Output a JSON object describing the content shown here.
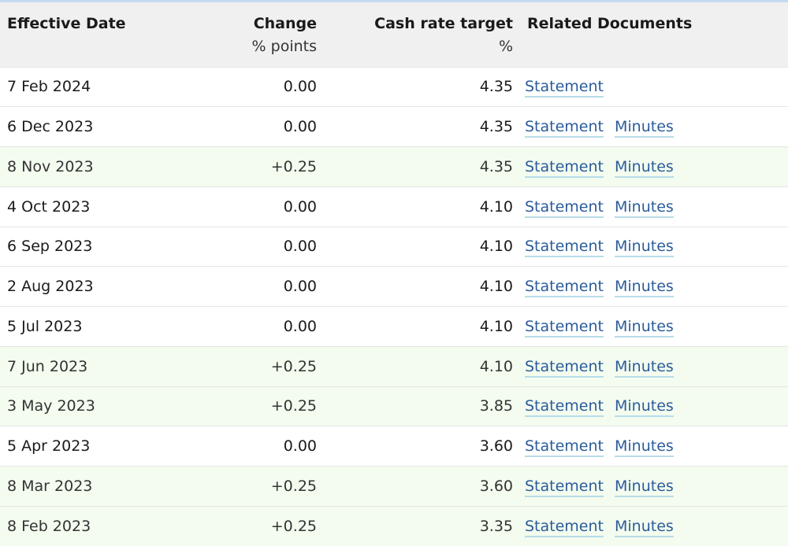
{
  "table": {
    "headers": {
      "date": "Effective Date",
      "change": "Change",
      "change_unit": "% points",
      "rate": "Cash rate target",
      "rate_unit": "%",
      "docs": "Related Documents"
    },
    "rows": [
      {
        "date": "7 Feb 2024",
        "change": "0.00",
        "rate": "4.35",
        "statement": "Statement",
        "minutes": "",
        "hike": false
      },
      {
        "date": "6 Dec 2023",
        "change": "0.00",
        "rate": "4.35",
        "statement": "Statement",
        "minutes": "Minutes",
        "hike": false
      },
      {
        "date": "8 Nov 2023",
        "change": "+0.25",
        "rate": "4.35",
        "statement": "Statement",
        "minutes": "Minutes",
        "hike": true
      },
      {
        "date": "4 Oct 2023",
        "change": "0.00",
        "rate": "4.10",
        "statement": "Statement",
        "minutes": "Minutes",
        "hike": false
      },
      {
        "date": "6 Sep 2023",
        "change": "0.00",
        "rate": "4.10",
        "statement": "Statement",
        "minutes": "Minutes",
        "hike": false
      },
      {
        "date": "2 Aug 2023",
        "change": "0.00",
        "rate": "4.10",
        "statement": "Statement",
        "minutes": "Minutes",
        "hike": false
      },
      {
        "date": "5 Jul 2023",
        "change": "0.00",
        "rate": "4.10",
        "statement": "Statement",
        "minutes": "Minutes",
        "hike": false
      },
      {
        "date": "7 Jun 2023",
        "change": "+0.25",
        "rate": "4.10",
        "statement": "Statement",
        "minutes": "Minutes",
        "hike": true
      },
      {
        "date": "3 May 2023",
        "change": "+0.25",
        "rate": "3.85",
        "statement": "Statement",
        "minutes": "Minutes",
        "hike": true
      },
      {
        "date": "5 Apr 2023",
        "change": "0.00",
        "rate": "3.60",
        "statement": "Statement",
        "minutes": "Minutes",
        "hike": false
      },
      {
        "date": "8 Mar 2023",
        "change": "+0.25",
        "rate": "3.60",
        "statement": "Statement",
        "minutes": "Minutes",
        "hike": true
      },
      {
        "date": "8 Feb 2023",
        "change": "+0.25",
        "rate": "3.35",
        "statement": "Statement",
        "minutes": "Minutes",
        "hike": true
      }
    ]
  },
  "colors": {
    "link": "#2a5c9a",
    "hike_row_bg": "#f3fcef",
    "header_bg": "#f0f0f0"
  }
}
